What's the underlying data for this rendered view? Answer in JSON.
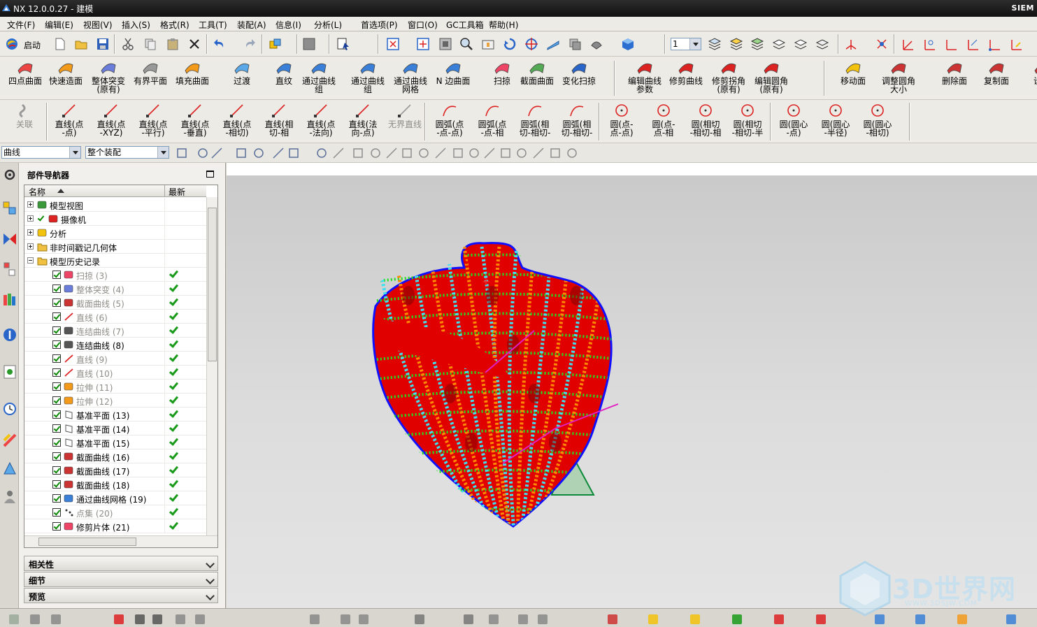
{
  "titlebar": {
    "title": "NX 12.0.0.27 - 建模",
    "brand": "SIEM"
  },
  "menus": [
    "文件(F)",
    "编辑(E)",
    "视图(V)",
    "插入(S)",
    "格式(R)",
    "工具(T)",
    "装配(A)",
    "信息(I)",
    "分析(L)",
    "首选项(P)",
    "窗口(O)",
    "GC工具箱",
    "帮助(H)"
  ],
  "toolbar1": {
    "start_label": "启动",
    "layer_value": "1"
  },
  "toolbar2": [
    {
      "label": "四点曲面"
    },
    {
      "label": "快速造面"
    },
    {
      "label": "整体突变\n(原有)"
    },
    {
      "label": "有界平面"
    },
    {
      "label": "填充曲面"
    },
    {
      "label": "过渡"
    },
    {
      "label": "直纹"
    },
    {
      "label": "通过曲线\n组"
    },
    {
      "label": "通过曲线\n组"
    },
    {
      "label": "通过曲线\n网格"
    },
    {
      "label": "N 边曲面"
    },
    {
      "label": "扫掠"
    },
    {
      "label": "截面曲面"
    },
    {
      "label": "变化扫掠"
    },
    {
      "label": "编辑曲线\n参数"
    },
    {
      "label": "修剪曲线"
    },
    {
      "label": "修剪拐角\n(原有)"
    },
    {
      "label": "编辑圆角\n(原有)"
    },
    {
      "label": "移动面"
    },
    {
      "label": "调整圆角\n大小"
    },
    {
      "label": "删除面"
    },
    {
      "label": "复制面"
    },
    {
      "label": "设为"
    }
  ],
  "toolbar3": [
    {
      "label": "关联"
    },
    {
      "label": "直线(点\n-点)"
    },
    {
      "label": "直线(点\n-XYZ)"
    },
    {
      "label": "直线(点\n-平行)"
    },
    {
      "label": "直线(点\n-垂直)"
    },
    {
      "label": "直线(点\n-相切)"
    },
    {
      "label": "直线(相\n切-相"
    },
    {
      "label": "直线(点\n-法向)"
    },
    {
      "label": "直线(法\n向-点)"
    },
    {
      "label": "无界直线"
    },
    {
      "label": "圆弧(点\n-点-点)"
    },
    {
      "label": "圆弧(点\n-点-相"
    },
    {
      "label": "圆弧(相\n切-相切-"
    },
    {
      "label": "圆弧(相\n切-相切-"
    },
    {
      "label": "圆(点-\n点-点)"
    },
    {
      "label": "圆(点-\n点-相"
    },
    {
      "label": "圆(相切\n-相切-相"
    },
    {
      "label": "圆(相切\n-相切-半"
    },
    {
      "label": "圆(圆心\n-点)"
    },
    {
      "label": "圆(圆心\n-半径)"
    },
    {
      "label": "圆(圆心\n-相切)"
    }
  ],
  "selection": {
    "filter": "曲线",
    "scope": "整个装配"
  },
  "navigator": {
    "title": "部件导航器",
    "col_name": "名称",
    "col_latest": "最新",
    "rows": [
      {
        "name": "模型视图",
        "expander": "plus",
        "indent": 0,
        "check": false,
        "ok": false,
        "dim": false,
        "icon": "model-views-icon"
      },
      {
        "name": "摄像机",
        "expander": "plus",
        "indent": 0,
        "check": true,
        "ok": false,
        "dim": false,
        "icon": "camera-icon"
      },
      {
        "name": "分析",
        "expander": "plus",
        "indent": 0,
        "check": false,
        "ok": false,
        "dim": false,
        "icon": "analysis-icon"
      },
      {
        "name": "非时间戳记几何体",
        "expander": "plus",
        "indent": 0,
        "check": false,
        "ok": false,
        "dim": false,
        "icon": "folder-icon"
      },
      {
        "name": "模型历史记录",
        "expander": "minus",
        "indent": 0,
        "check": false,
        "ok": false,
        "dim": false,
        "icon": "folder-open-icon"
      },
      {
        "name": "扫掠  (3)",
        "indent": 1,
        "check": true,
        "ok": true,
        "dim": true,
        "icon": "swept-icon"
      },
      {
        "name": "整体突变  (4)",
        "indent": 1,
        "check": true,
        "ok": true,
        "dim": true,
        "icon": "global-shaping-icon"
      },
      {
        "name": "截面曲线  (5)",
        "indent": 1,
        "check": true,
        "ok": true,
        "dim": true,
        "icon": "section-curve-icon"
      },
      {
        "name": "直线  (6)",
        "indent": 1,
        "check": true,
        "ok": true,
        "dim": true,
        "icon": "line-icon"
      },
      {
        "name": "连结曲线  (7)",
        "indent": 1,
        "check": true,
        "ok": true,
        "dim": true,
        "icon": "join-curve-icon"
      },
      {
        "name": "连结曲线  (8)",
        "indent": 1,
        "check": true,
        "ok": true,
        "dim": false,
        "icon": "join-curve-icon"
      },
      {
        "name": "直线  (9)",
        "indent": 1,
        "check": true,
        "ok": true,
        "dim": true,
        "icon": "line-icon"
      },
      {
        "name": "直线  (10)",
        "indent": 1,
        "check": true,
        "ok": true,
        "dim": true,
        "icon": "line-icon"
      },
      {
        "name": "拉伸  (11)",
        "indent": 1,
        "check": true,
        "ok": true,
        "dim": true,
        "icon": "extrude-icon"
      },
      {
        "name": "拉伸  (12)",
        "indent": 1,
        "check": true,
        "ok": true,
        "dim": true,
        "icon": "extrude-icon"
      },
      {
        "name": "基准平面  (13)",
        "indent": 1,
        "check": true,
        "ok": true,
        "dim": false,
        "icon": "datum-plane-icon"
      },
      {
        "name": "基准平面  (14)",
        "indent": 1,
        "check": true,
        "ok": true,
        "dim": false,
        "icon": "datum-plane-icon"
      },
      {
        "name": "基准平面  (15)",
        "indent": 1,
        "check": true,
        "ok": true,
        "dim": false,
        "icon": "datum-plane-icon"
      },
      {
        "name": "截面曲线  (16)",
        "indent": 1,
        "check": true,
        "ok": true,
        "dim": false,
        "icon": "section-curve-icon"
      },
      {
        "name": "截面曲线  (17)",
        "indent": 1,
        "check": true,
        "ok": true,
        "dim": false,
        "icon": "section-curve-icon"
      },
      {
        "name": "截面曲线  (18)",
        "indent": 1,
        "check": true,
        "ok": true,
        "dim": false,
        "icon": "section-curve-icon"
      },
      {
        "name": "通过曲线网格  (19)",
        "indent": 1,
        "check": true,
        "ok": true,
        "dim": false,
        "icon": "through-curve-mesh-icon"
      },
      {
        "name": "点集  (20)",
        "indent": 1,
        "check": true,
        "ok": true,
        "dim": true,
        "icon": "point-set-icon"
      },
      {
        "name": "修剪片体  (21)",
        "indent": 1,
        "check": true,
        "ok": true,
        "dim": false,
        "icon": "trim-sheet-icon"
      }
    ],
    "sections": [
      "相关性",
      "细节",
      "预览"
    ]
  },
  "watermark": {
    "main": "3D世界网",
    "sub": "WWW.3DSJW.COM"
  },
  "colors": {
    "surface": "#e00000",
    "curve_green": "#22e022",
    "curve_cyan": "#40e0f0",
    "curve_orange": "#ff8a00",
    "curve_blue": "#1010ff"
  }
}
